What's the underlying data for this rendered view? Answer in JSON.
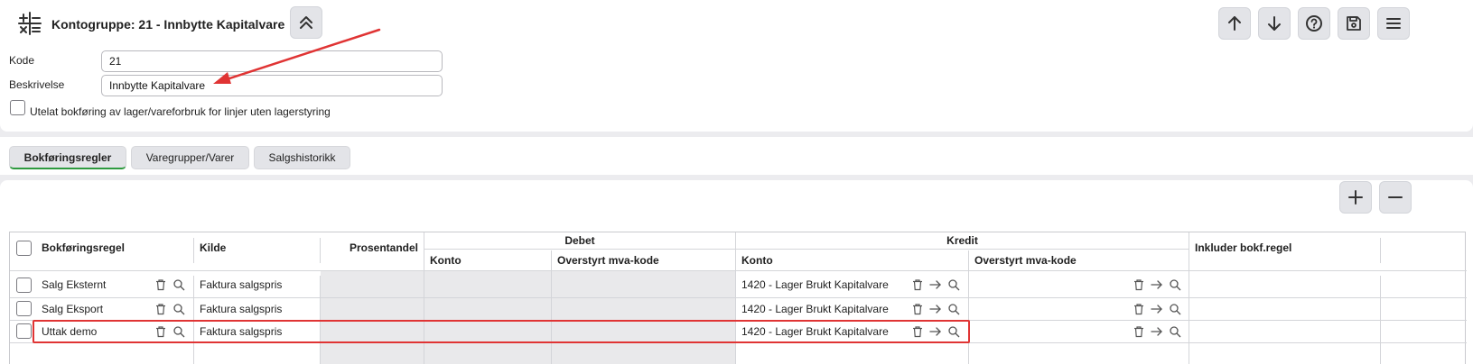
{
  "header": {
    "title": "Kontogruppe: 21 - Innbytte Kapitalvare",
    "icon": "calculator-icon",
    "actions": [
      "arrow-up-icon",
      "arrow-down-icon",
      "help-icon",
      "save-icon",
      "menu-icon"
    ]
  },
  "form": {
    "kode_label": "Kode",
    "kode_value": "21",
    "beskrivelse_label": "Beskrivelse",
    "beskrivelse_value": "Innbytte Kapitalvare",
    "checkbox_label": "Utelat bokføring av lager/vareforbruk for linjer uten lagerstyring",
    "checkbox_checked": false
  },
  "tabs": [
    {
      "label": "Bokføringsregler",
      "active": true
    },
    {
      "label": "Varegrupper/Varer",
      "active": false
    },
    {
      "label": "Salgshistorikk",
      "active": false
    }
  ],
  "grid": {
    "headers": {
      "bokforingsregel": "Bokføringsregel",
      "kilde": "Kilde",
      "prosentandel": "Prosentandel",
      "debet": "Debet",
      "debet_konto": "Konto",
      "debet_mva": "Overstyrt mva-kode",
      "kredit": "Kredit",
      "kredit_konto": "Konto",
      "kredit_mva": "Overstyrt mva-kode",
      "inkluder": "Inkluder bokf.regel"
    },
    "rows": [
      {
        "regel": "Salg Eksternt",
        "kilde": "Faktura salgspris",
        "kredit_konto": "1420 - Lager Brukt Kapitalvare"
      },
      {
        "regel": "Salg Eksport",
        "kilde": "Faktura salgspris",
        "kredit_konto": "1420 - Lager Brukt Kapitalvare"
      },
      {
        "regel": "Uttak demo",
        "kilde": "Faktura salgspris",
        "kredit_konto": "1420 - Lager Brukt Kapitalvare"
      }
    ]
  },
  "colors": {
    "active_tab_underline": "#2e9a3f",
    "annotation": "#e03434"
  }
}
